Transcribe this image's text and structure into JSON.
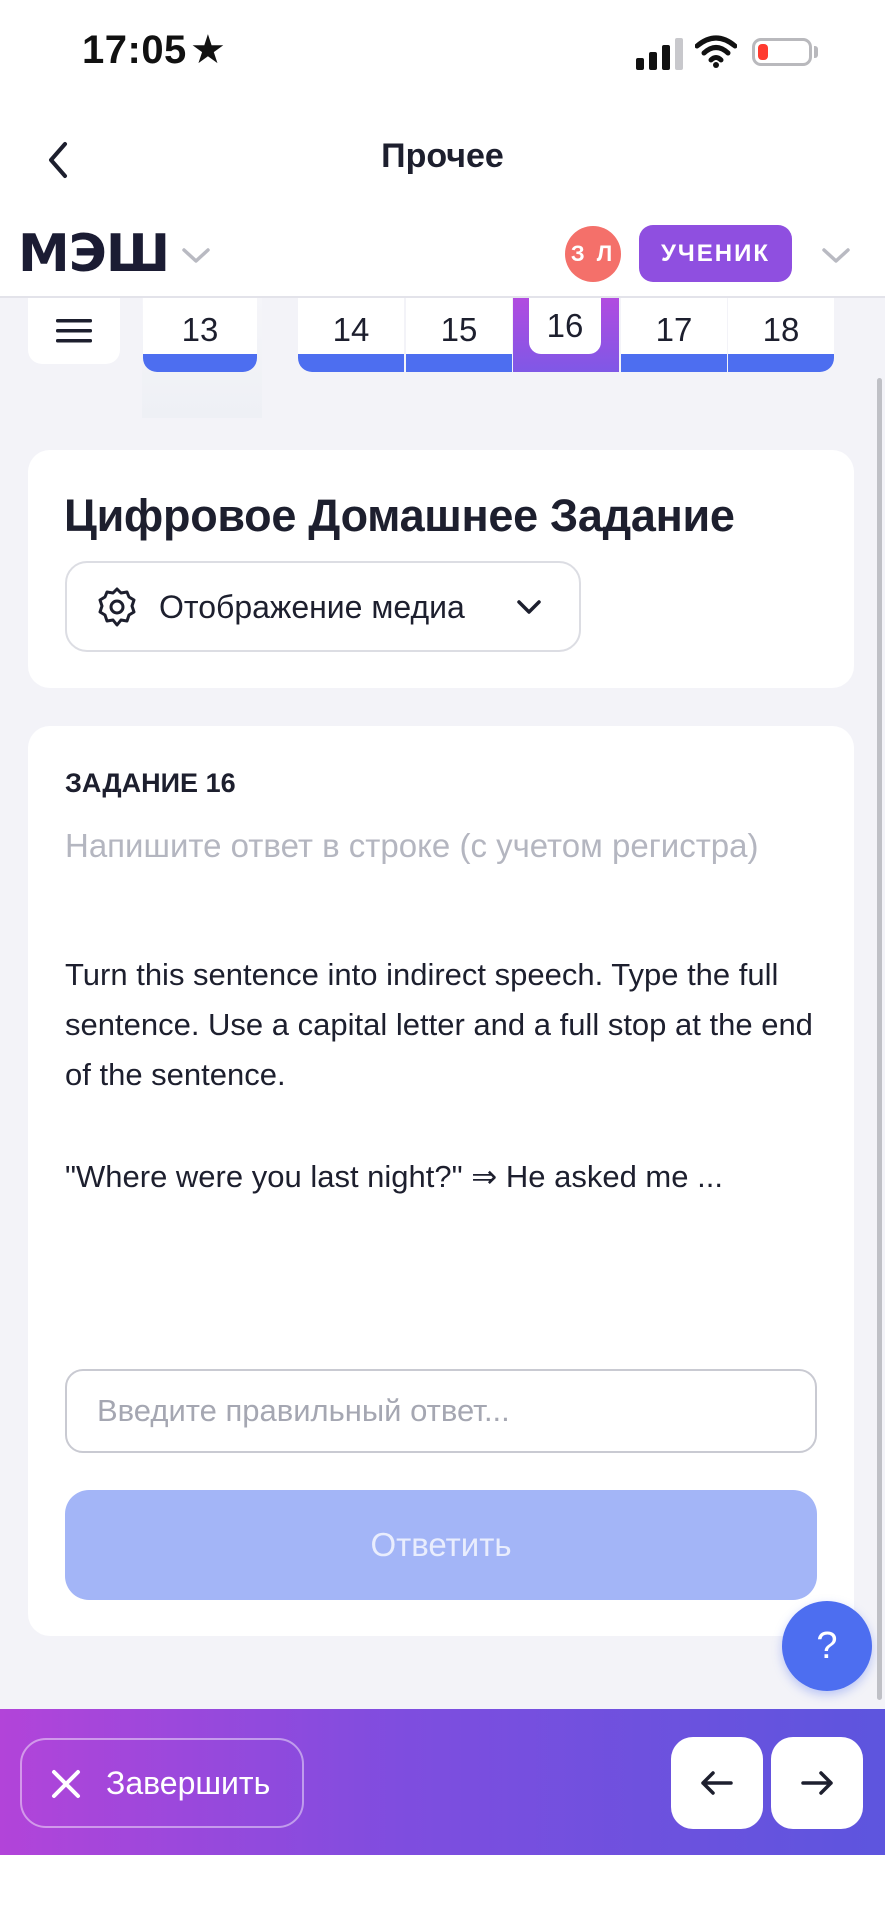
{
  "status_bar": {
    "time": "17:05",
    "star": "★",
    "icons": [
      "signal-icon",
      "wifi-icon",
      "battery-icon"
    ],
    "battery_color": "#ff3b30"
  },
  "nav": {
    "back_icon": "chevron-left-icon",
    "title": "Прочее"
  },
  "header": {
    "logo": "МЭШ",
    "avatar_initials": "З Л",
    "role": "УЧЕНИК",
    "avatar_color": "#f4706a",
    "role_color": "#8f4fe0"
  },
  "tabs": {
    "menu_icon": "hamburger-icon",
    "items": [
      "13",
      "14",
      "15",
      "16",
      "17",
      "18"
    ],
    "active": "16",
    "accent": "#4d6ef0"
  },
  "homework": {
    "title": "Цифровое Домашнее Задание",
    "media_toggle": "Отображение медиа"
  },
  "task": {
    "label": "ЗАДАНИЕ 16",
    "hint": "Напишите ответ в строке (с учетом регистра)",
    "instruction": "Turn this sentence into indirect speech. Type the full sentence. Use a capital letter and a full stop at the end of the sentence.",
    "example": "\"Where were you last night?\" ⇒ He asked me ...",
    "answer_value": "",
    "answer_placeholder": "Введите правильный ответ...",
    "submit_label": "Ответить"
  },
  "help": {
    "label": "?"
  },
  "footer": {
    "finish_label": "Завершить",
    "prev_icon": "arrow-left-icon",
    "next_icon": "arrow-right-icon"
  }
}
